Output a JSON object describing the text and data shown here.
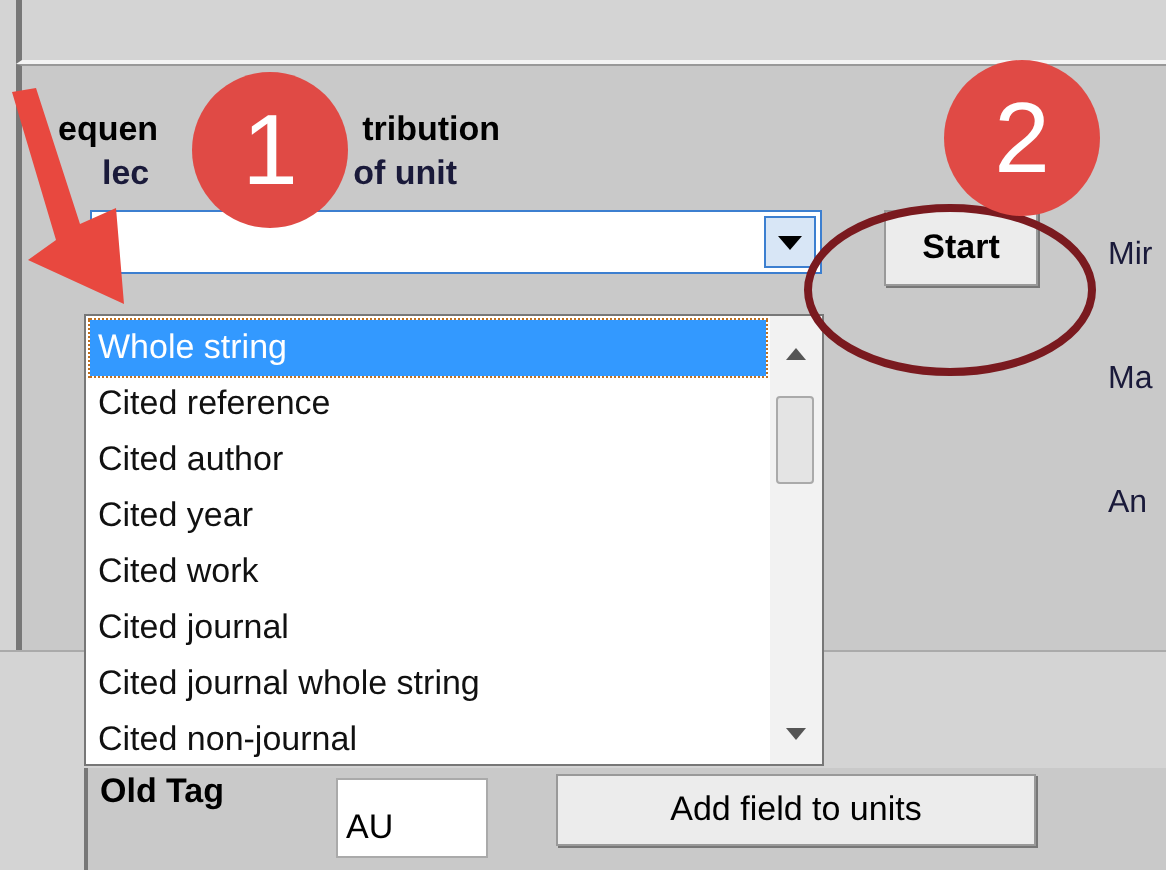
{
  "heading_fragments": [
    "equen",
    "tribution"
  ],
  "subheading_fragments": [
    "lec",
    "of unit"
  ],
  "unit_select": {
    "expanded": true
  },
  "options": [
    {
      "label": "Whole string",
      "selected": true
    },
    {
      "label": "Cited reference",
      "selected": false
    },
    {
      "label": "Cited author",
      "selected": false
    },
    {
      "label": "Cited year",
      "selected": false
    },
    {
      "label": "Cited work",
      "selected": false
    },
    {
      "label": "Cited journal",
      "selected": false
    },
    {
      "label": "Cited journal whole string",
      "selected": false
    },
    {
      "label": "Cited non-journal",
      "selected": false
    }
  ],
  "start_button": "Start",
  "right_labels": [
    "Mir",
    "Ma",
    "An"
  ],
  "old_tag": {
    "label": "Old Tag",
    "value": "AU"
  },
  "add_button": "Add field to units",
  "callouts": [
    "1",
    "2"
  ]
}
